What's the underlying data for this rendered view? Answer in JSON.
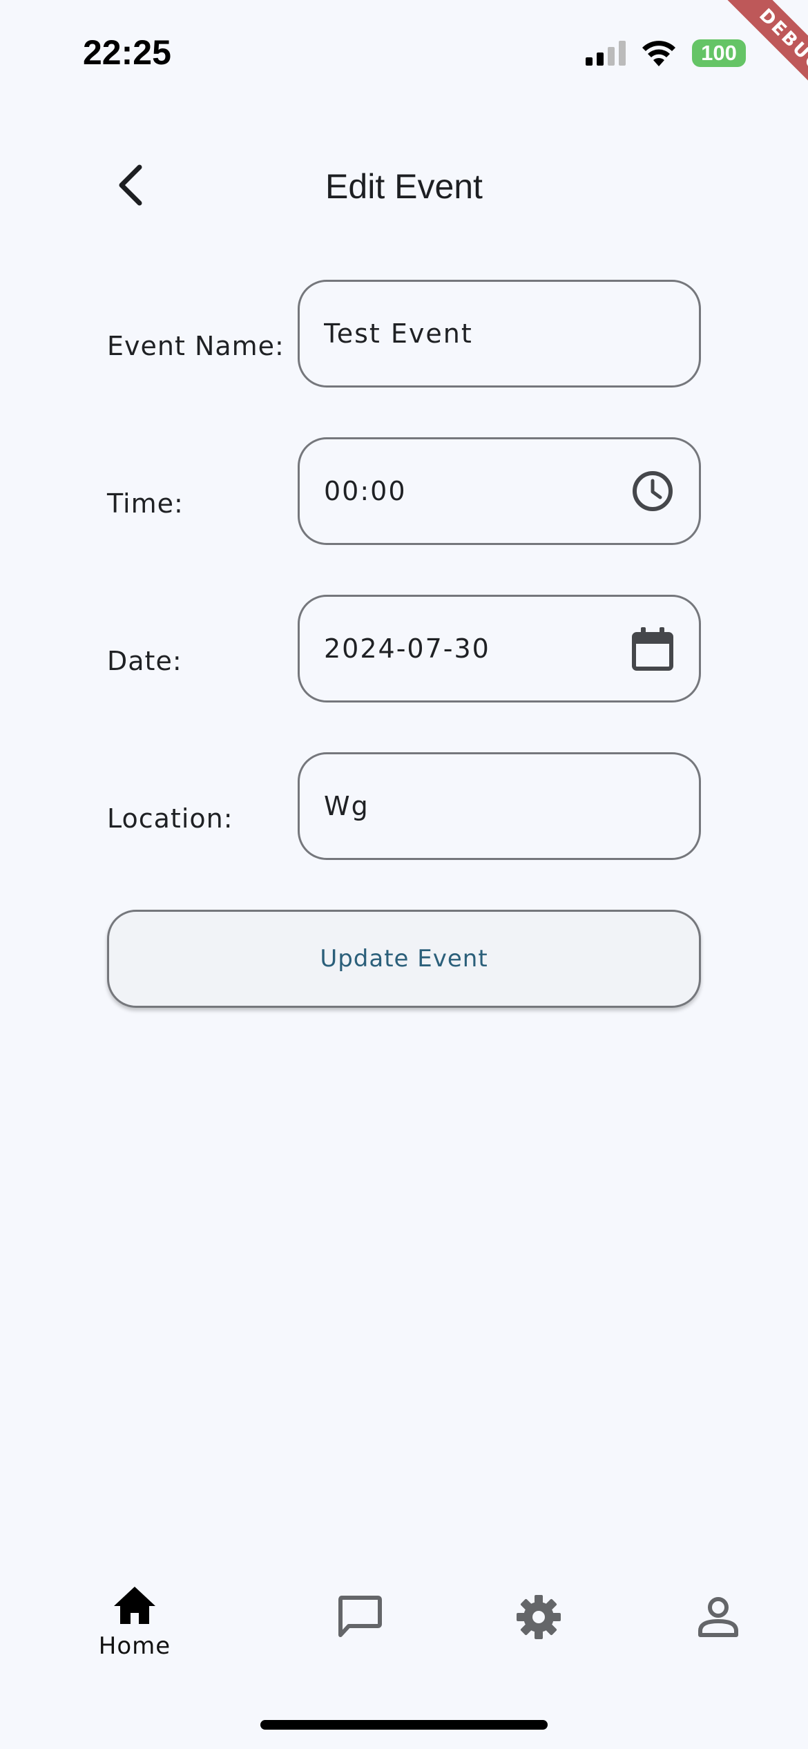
{
  "status_bar": {
    "time": "22:25",
    "battery": "100",
    "signal_icon": "cell-signal-icon",
    "wifi_icon": "wifi-icon",
    "battery_color": "#65c466"
  },
  "debug_banner": "DEBUG",
  "app_bar": {
    "title": "Edit Event",
    "back_icon": "chevron-left-icon"
  },
  "form": {
    "event_name": {
      "label": "Event Name:",
      "value": "Test Event"
    },
    "time": {
      "label": "Time:",
      "value": "00:00",
      "icon": "clock-icon"
    },
    "date": {
      "label": "Date:",
      "value": "2024-07-30",
      "icon": "calendar-icon"
    },
    "location": {
      "label": "Location:",
      "value": "Wg"
    },
    "submit_label": "Update Event",
    "submit_text_color": "#2b5f7a"
  },
  "bottom_nav": {
    "items": [
      {
        "label": "Home",
        "icon": "home-icon",
        "selected": true
      },
      {
        "label": "",
        "icon": "chat-icon",
        "selected": false
      },
      {
        "label": "",
        "icon": "gear-icon",
        "selected": false
      },
      {
        "label": "",
        "icon": "person-icon",
        "selected": false
      }
    ]
  }
}
